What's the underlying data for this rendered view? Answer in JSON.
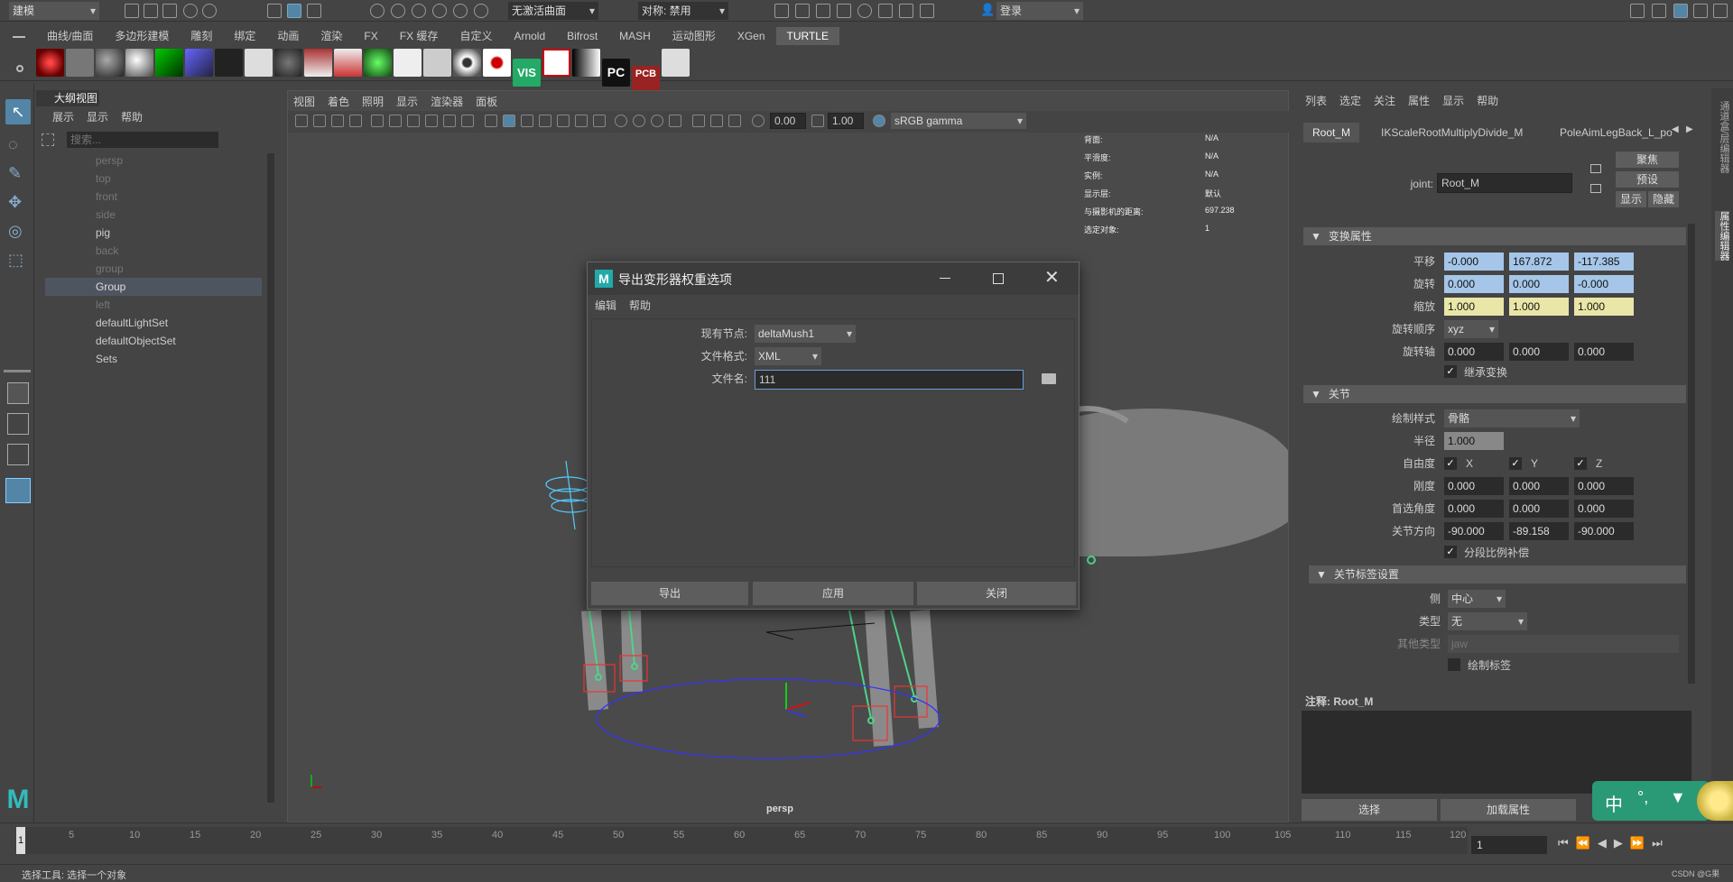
{
  "top": {
    "mode": "建模",
    "live_surface": "无激活曲面",
    "symmetry": "对称: 禁用",
    "login": "登录"
  },
  "tabs": [
    "曲线/曲面",
    "多边形建模",
    "雕刻",
    "绑定",
    "动画",
    "渲染",
    "FX",
    "FX 缓存",
    "自定义",
    "Arnold",
    "Bifrost",
    "MASH",
    "运动图形",
    "XGen",
    "TURTLE"
  ],
  "active_tab": "TURTLE",
  "shelf_labels": {
    "vis": "VIS",
    "pc": "PC",
    "pcb": "PCB"
  },
  "outliner": {
    "title": "大纲视图",
    "menu": [
      "展示",
      "显示",
      "帮助"
    ],
    "search_placeholder": "搜索...",
    "items": [
      "persp",
      "top",
      "front",
      "side",
      "pig",
      "back",
      "group",
      "Group",
      "left",
      "defaultLightSet",
      "defaultObjectSet",
      "Sets"
    ]
  },
  "viewport": {
    "menu": [
      "视图",
      "着色",
      "照明",
      "显示",
      "渲染器",
      "面板"
    ],
    "val1": "0.00",
    "val2": "1.00",
    "color_space": "sRGB gamma",
    "camera": "persp",
    "hud": [
      {
        "label": "背面:",
        "value": "N/A"
      },
      {
        "label": "平滑度:",
        "value": "N/A"
      },
      {
        "label": "实例:",
        "value": "N/A"
      },
      {
        "label": "显示层:",
        "value": "默认"
      },
      {
        "label": "与摄影机的距离:",
        "value": "697.238"
      },
      {
        "label": "选定对象:",
        "value": "1"
      }
    ]
  },
  "dialog": {
    "title": "导出变形器权重选项",
    "menu": [
      "编辑",
      "帮助"
    ],
    "node_label": "现有节点:",
    "node_value": "deltaMush1",
    "format_label": "文件格式:",
    "format_value": "XML",
    "filename_label": "文件名:",
    "filename_value": "111",
    "buttons": [
      "导出",
      "应用",
      "关闭"
    ]
  },
  "attr_editor": {
    "menu": [
      "列表",
      "选定",
      "关注",
      "属性",
      "显示",
      "帮助"
    ],
    "tabs": [
      "Root_M",
      "IKScaleRootMultiplyDivide_M",
      "PoleAimLegBack_L_po"
    ],
    "joint_label": "joint:",
    "joint_value": "Root_M",
    "side_buttons": [
      "聚焦",
      "预设",
      "显示",
      "隐藏"
    ],
    "transform_section": "变换属性",
    "translate_label": "平移",
    "translate": [
      "-0.000",
      "167.872",
      "-117.385"
    ],
    "rotate_label": "旋转",
    "rotate": [
      "0.000",
      "0.000",
      "-0.000"
    ],
    "scale_label": "缩放",
    "scale": [
      "1.000",
      "1.000",
      "1.000"
    ],
    "rotate_order_label": "旋转顺序",
    "rotate_order": "xyz",
    "rotate_axis_label": "旋转轴",
    "rotate_axis": [
      "0.000",
      "0.000",
      "0.000"
    ],
    "inherit_label": "继承变换",
    "joint_section": "关节",
    "draw_style_label": "绘制样式",
    "draw_style": "骨骼",
    "radius_label": "半径",
    "radius": "1.000",
    "dof_label": "自由度",
    "dof": [
      "X",
      "Y",
      "Z"
    ],
    "stiffness_label": "刚度",
    "stiffness": [
      "0.000",
      "0.000",
      "0.000"
    ],
    "pref_angle_label": "首选角度",
    "pref_angle": [
      "0.000",
      "0.000",
      "0.000"
    ],
    "joint_orient_label": "关节方向",
    "joint_orient": [
      "-90.000",
      "-89.158",
      "-90.000"
    ],
    "segment_scale_label": "分段比例补偿",
    "label_section": "关节标签设置",
    "side_label": "侧",
    "side_value": "中心",
    "type_label": "类型",
    "type_value": "无",
    "other_type_label": "其他类型",
    "other_type_value": "jaw",
    "draw_label_label": "绘制标签",
    "notes_label": "注释:",
    "notes_value": "Root_M",
    "bottom_buttons": [
      "选择",
      "加载属性"
    ]
  },
  "right_strip": [
    "通道盒/层编辑器",
    "属性编辑器"
  ],
  "timeline": {
    "ticks": [
      "5",
      "10",
      "15",
      "20",
      "25",
      "30",
      "35",
      "40",
      "45",
      "50",
      "55",
      "60",
      "65",
      "70",
      "75",
      "80",
      "85",
      "90",
      "95",
      "100",
      "105",
      "110",
      "115",
      "120"
    ],
    "start": "1",
    "current": "1"
  },
  "ime": {
    "text": "中"
  },
  "status": "选择工具: 选择一个对象",
  "watermark": "CSDN @G果"
}
